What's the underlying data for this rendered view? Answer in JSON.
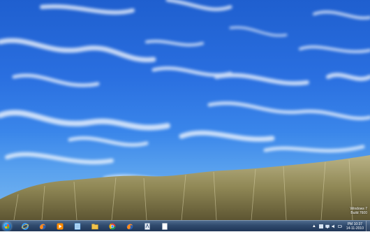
{
  "watermark": {
    "line1": "Windows 7",
    "line2": "Build 7600"
  },
  "taskbar": {
    "apps": [
      {
        "name": "internet-explorer-icon"
      },
      {
        "name": "firefox-icon"
      },
      {
        "name": "media-player-icon"
      },
      {
        "name": "notepad-icon"
      },
      {
        "name": "explorer-icon"
      },
      {
        "name": "chrome-icon"
      },
      {
        "name": "firefox-icon"
      },
      {
        "name": "document-icon"
      },
      {
        "name": "blank-document-icon"
      }
    ],
    "clock": {
      "time": "PM 10:37",
      "date": "14-11-2010"
    }
  },
  "colors": {
    "sky_top": "#1f5fcf",
    "sky_bottom": "#7bb8f0",
    "taskbar": "#2f4a6d",
    "grass": "#8f8755"
  }
}
